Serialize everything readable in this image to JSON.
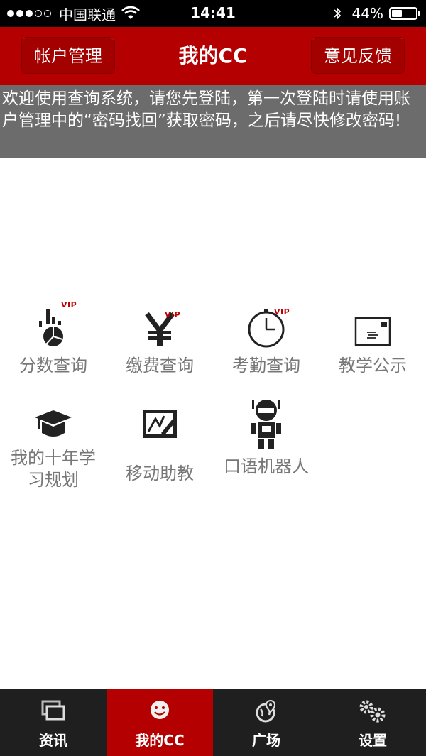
{
  "status_bar": {
    "carrier": "中国联通",
    "time": "14:41",
    "battery": "44%",
    "battery_level": 0.44,
    "signal_bars_filled": 3,
    "signal_bars_total": 5
  },
  "nav": {
    "left_button": "帐户管理",
    "title": "我的CC",
    "right_button": "意见反馈"
  },
  "notice": {
    "text": "欢迎使用查询系统，请您先登陆，第一次登陆时请使用账户管理中的“密码找回”获取密码，之后请尽快修改密码!"
  },
  "grid": {
    "vip_label": "VIP",
    "items": [
      {
        "label": "分数查询",
        "icon": "score-chart-icon",
        "vip": true
      },
      {
        "label": "缴费查询",
        "icon": "yen-icon",
        "vip": true
      },
      {
        "label": "考勤查询",
        "icon": "clock-icon",
        "vip": true
      },
      {
        "label": "教学公示",
        "icon": "envelope-icon",
        "vip": false
      },
      {
        "label": "我的十年学习规划",
        "icon": "graduation-cap-icon",
        "vip": false
      },
      {
        "label": "移动助教",
        "icon": "pencil-board-icon",
        "vip": false
      },
      {
        "label": "口语机器人",
        "icon": "robot-icon",
        "vip": false
      }
    ]
  },
  "tabs": [
    {
      "label": "资讯",
      "icon": "windows-icon",
      "active": false
    },
    {
      "label": "我的CC",
      "icon": "smiley-icon",
      "active": true
    },
    {
      "label": "广场",
      "icon": "location-globe-icon",
      "active": false
    },
    {
      "label": "设置",
      "icon": "gears-icon",
      "active": false
    }
  ],
  "colors": {
    "brand_red": "#b40000",
    "notice_gray": "#6c6c6c",
    "tabbar_dark": "#1f1f1f",
    "vip_red": "#c00000"
  }
}
